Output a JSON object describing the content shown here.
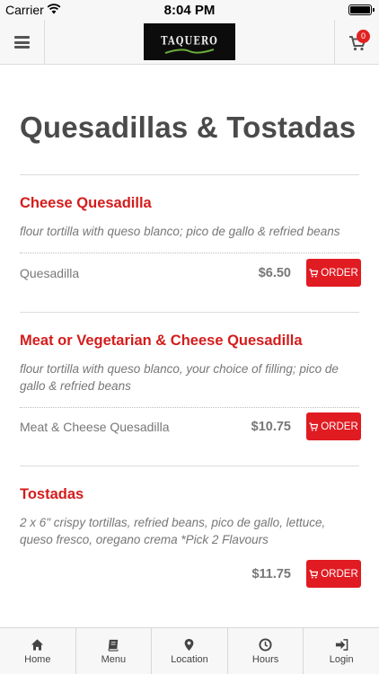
{
  "status_bar": {
    "carrier": "Carrier",
    "time": "8:04 PM"
  },
  "header": {
    "logo_text": "TAQUERO",
    "cart_count": "0"
  },
  "page": {
    "title": "Quesadillas & Tostadas"
  },
  "items": [
    {
      "name": "Cheese Quesadilla",
      "description": "flour tortilla with queso blanco; pico de gallo & refried beans",
      "option": "Quesadilla",
      "price": "$6.50",
      "order_label": "ORDER"
    },
    {
      "name": "Meat or Vegetarian & Cheese Quesadilla",
      "description": "flour tortilla with queso blanco, your choice of filling; pico de gallo & refried beans",
      "option": "Meat & Cheese Quesadilla",
      "price": "$10.75",
      "order_label": "ORDER"
    },
    {
      "name": "Tostadas",
      "description": "2 x 6\" crispy tortillas, refried beans, pico de gallo, lettuce, queso fresco, oregano crema *Pick 2 Flavours",
      "option": "",
      "price": "$11.75",
      "order_label": "ORDER"
    }
  ],
  "tabs": [
    {
      "label": "Home",
      "icon": "home-icon"
    },
    {
      "label": "Menu",
      "icon": "book-icon"
    },
    {
      "label": "Location",
      "icon": "map-pin-icon"
    },
    {
      "label": "Hours",
      "icon": "clock-icon"
    },
    {
      "label": "Login",
      "icon": "sign-in-icon"
    }
  ],
  "colors": {
    "accent": "#e11b22",
    "item_name": "#d41c1c",
    "text_muted": "#777777",
    "title": "#4a4a4a"
  }
}
